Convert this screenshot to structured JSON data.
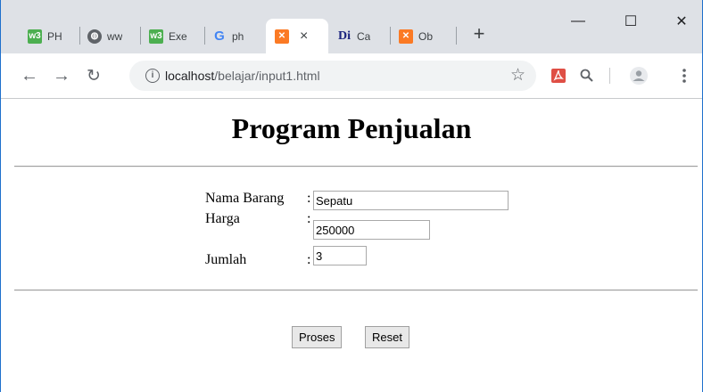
{
  "browser": {
    "tabs": [
      {
        "label": "PH",
        "icon": "w3schools-icon",
        "active": false
      },
      {
        "label": "ww",
        "icon": "globe-icon",
        "active": false
      },
      {
        "label": "Exe",
        "icon": "w3schools-icon",
        "active": false
      },
      {
        "label": "ph",
        "icon": "google-icon",
        "active": false
      },
      {
        "label": "×",
        "icon": "xampp-icon",
        "active": true
      },
      {
        "label": "Ca",
        "icon": "dictionary-icon",
        "active": false
      },
      {
        "label": "Ob",
        "icon": "xampp-icon",
        "active": false
      }
    ],
    "new_tab": "+",
    "window_controls": {
      "minimize": "—",
      "maximize": "☐",
      "close": "✕"
    },
    "url_host": "localhost",
    "url_path": "/belajar/input1.html"
  },
  "page": {
    "title": "Program Penjualan",
    "fields": [
      {
        "label": "Nama Barang",
        "colon": ":",
        "value": "Sepatu"
      },
      {
        "label": "Harga",
        "colon": ":",
        "value": "250000"
      },
      {
        "label": "Jumlah",
        "colon": ":",
        "value": "3"
      }
    ],
    "buttons": {
      "submit": "Proses",
      "reset": "Reset"
    }
  },
  "colors": {
    "tabstrip": "#dee1e6",
    "window_border": "#1e70cc",
    "w3schools": "#4caf50",
    "xampp": "#fb7a24"
  }
}
